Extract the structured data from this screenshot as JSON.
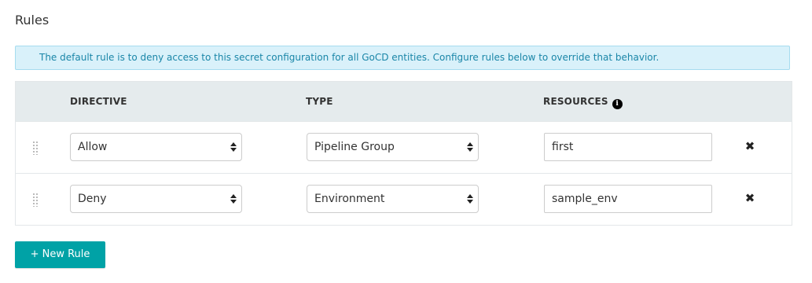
{
  "section": {
    "title": "Rules",
    "info_message": "The default rule is to deny access to this secret configuration for all GoCD entities. Configure rules below to override that behavior."
  },
  "table": {
    "headers": {
      "directive": "DIRECTIVE",
      "type": "TYPE",
      "resources": "RESOURCES",
      "resources_info_icon": "info-circle-icon"
    },
    "rows": [
      {
        "directive": "Allow",
        "type": "Pipeline Group",
        "resource": "first"
      },
      {
        "directive": "Deny",
        "type": "Environment",
        "resource": "sample_env"
      }
    ]
  },
  "actions": {
    "new_rule_label": "+ New Rule"
  },
  "icons": {
    "drag": "drag-handle-icon",
    "delete": "close-icon",
    "delete_glyph": "✖",
    "info_glyph": "i"
  },
  "colors": {
    "primary_button": "#00a2a6",
    "info_background": "#d9f1fa",
    "info_text": "#1a86a8",
    "header_background": "#e5ebed"
  }
}
